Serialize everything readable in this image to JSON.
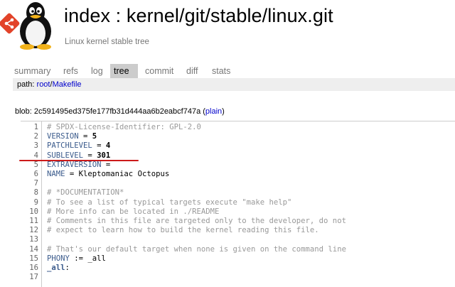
{
  "header": {
    "title": "index : kernel/git/stable/linux.git",
    "subtitle": "Linux kernel stable tree"
  },
  "tabs": [
    {
      "label": "summary",
      "active": false
    },
    {
      "label": "refs",
      "active": false
    },
    {
      "label": "log",
      "active": false
    },
    {
      "label": "tree",
      "active": true
    },
    {
      "label": "commit",
      "active": false
    },
    {
      "label": "diff",
      "active": false
    },
    {
      "label": "stats",
      "active": false
    }
  ],
  "path": {
    "label": "path:",
    "root": "root",
    "separator": "/",
    "file": "Makefile"
  },
  "blob": {
    "prefix": "blob: 2c591495ed375fe177fb31d444aa6b2eabcf747a (",
    "plain": "plain",
    "suffix": ")"
  },
  "code_lines": [
    {
      "n": "1",
      "parts": [
        {
          "t": "# SPDX-License-Identifier: GPL-2.0",
          "c": "comment"
        }
      ]
    },
    {
      "n": "2",
      "parts": [
        {
          "t": "VERSION",
          "c": "ident"
        },
        {
          "t": " = ",
          "c": "plain"
        },
        {
          "t": "5",
          "c": "bold"
        }
      ]
    },
    {
      "n": "3",
      "parts": [
        {
          "t": "PATCHLEVEL",
          "c": "ident"
        },
        {
          "t": " = ",
          "c": "plain"
        },
        {
          "t": "4",
          "c": "bold"
        }
      ]
    },
    {
      "n": "4",
      "parts": [
        {
          "t": "SUBLEVEL",
          "c": "ident"
        },
        {
          "t": " = ",
          "c": "plain"
        },
        {
          "t": "301",
          "c": "bold"
        }
      ]
    },
    {
      "n": "5",
      "parts": [
        {
          "t": "EXTRAVERSION",
          "c": "ident"
        },
        {
          "t": " =",
          "c": "plain"
        }
      ]
    },
    {
      "n": "6",
      "parts": [
        {
          "t": "NAME",
          "c": "ident"
        },
        {
          "t": " = Kleptomaniac Octopus",
          "c": "plain"
        }
      ]
    },
    {
      "n": "7",
      "parts": []
    },
    {
      "n": "8",
      "parts": [
        {
          "t": "# *DOCUMENTATION*",
          "c": "comment"
        }
      ]
    },
    {
      "n": "9",
      "parts": [
        {
          "t": "# To see a list of typical targets execute \"make help\"",
          "c": "comment"
        }
      ]
    },
    {
      "n": "10",
      "parts": [
        {
          "t": "# More info can be located in ./README",
          "c": "comment"
        }
      ]
    },
    {
      "n": "11",
      "parts": [
        {
          "t": "# Comments in this file are targeted only to the developer, do not",
          "c": "comment"
        }
      ]
    },
    {
      "n": "12",
      "parts": [
        {
          "t": "# expect to learn how to build the kernel reading this file.",
          "c": "comment"
        }
      ]
    },
    {
      "n": "13",
      "parts": []
    },
    {
      "n": "14",
      "parts": [
        {
          "t": "# That's our default target when none is given on the command line",
          "c": "comment"
        }
      ]
    },
    {
      "n": "15",
      "parts": [
        {
          "t": "PHONY",
          "c": "ident"
        },
        {
          "t": " := _all",
          "c": "plain"
        }
      ]
    },
    {
      "n": "16",
      "parts": [
        {
          "t": "_all",
          "c": "ident-bold"
        },
        {
          "t": ":",
          "c": "plain"
        }
      ]
    },
    {
      "n": "17",
      "parts": []
    }
  ],
  "colors": {
    "annotation": "#cc1a1a",
    "link": "#0000cc",
    "active_tab": "#cccccc",
    "path_bar": "#eeeeee"
  }
}
